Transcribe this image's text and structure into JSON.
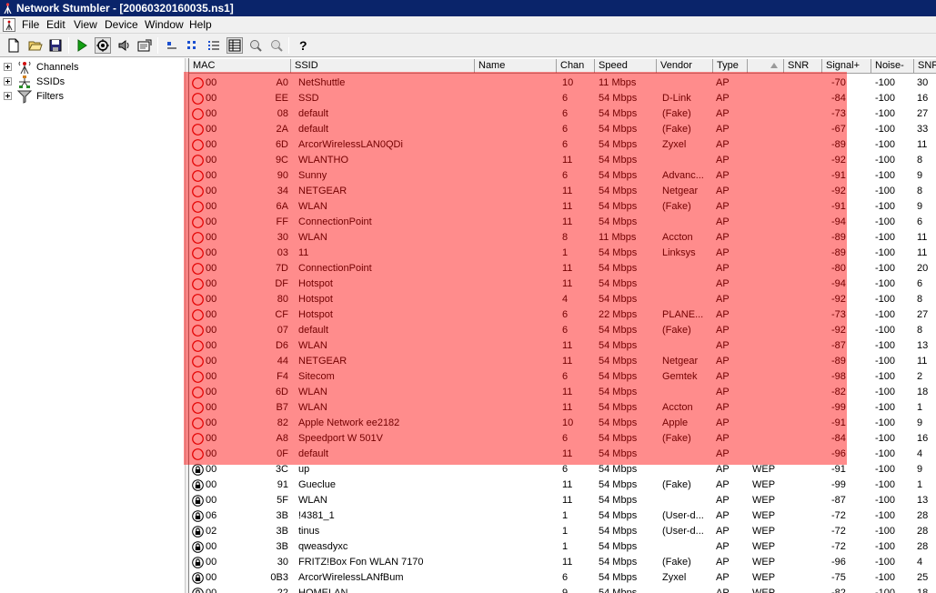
{
  "window": {
    "title": "Network Stumbler - [20060320160035.ns1]"
  },
  "menu": [
    "File",
    "Edit",
    "View",
    "Device",
    "Window",
    "Help"
  ],
  "toolbar_icons": [
    "new-file-icon",
    "open-folder-icon",
    "save-icon",
    "play-icon",
    "auto-config-icon",
    "speaker-icon",
    "properties-icon",
    "large-icons-icon",
    "small-icons-icon",
    "list-icon",
    "details-icon",
    "zoom-in-icon",
    "zoom-out-icon",
    "help-icon"
  ],
  "tree": [
    {
      "label": "Channels",
      "icon": "antenna-icon"
    },
    {
      "label": "SSIDs",
      "icon": "network-icon"
    },
    {
      "label": "Filters",
      "icon": "funnel-icon"
    }
  ],
  "columns": [
    "MAC",
    "SSID",
    "Name",
    "Chan",
    "Speed",
    "Vendor",
    "Type",
    "",
    "SNR",
    "Signal+",
    "Noise-",
    "SNR"
  ],
  "rows": [
    {
      "icon": "open",
      "mac": "00",
      "mac_tail": "A0",
      "ssid": "NetShuttle",
      "chan": "10",
      "speed": "11 Mbps",
      "vendor": "",
      "type": "AP",
      "enc": "",
      "signal": "-70",
      "noise": "-100",
      "snr": "30"
    },
    {
      "icon": "open",
      "mac": "00",
      "mac_tail": "EE",
      "ssid": "SSD",
      "chan": "6",
      "speed": "54 Mbps",
      "vendor": "D-Link",
      "type": "AP",
      "enc": "",
      "signal": "-84",
      "noise": "-100",
      "snr": "16"
    },
    {
      "icon": "open",
      "mac": "00",
      "mac_tail": "08",
      "ssid": "default",
      "chan": "6",
      "speed": "54 Mbps",
      "vendor": "(Fake)",
      "type": "AP",
      "enc": "",
      "signal": "-73",
      "noise": "-100",
      "snr": "27"
    },
    {
      "icon": "open",
      "mac": "00",
      "mac_tail": "2A",
      "ssid": "default",
      "chan": "6",
      "speed": "54 Mbps",
      "vendor": "(Fake)",
      "type": "AP",
      "enc": "",
      "signal": "-67",
      "noise": "-100",
      "snr": "33"
    },
    {
      "icon": "open",
      "mac": "00",
      "mac_tail": "6D",
      "ssid": "ArcorWirelessLAN0QDi",
      "chan": "6",
      "speed": "54 Mbps",
      "vendor": "Zyxel",
      "type": "AP",
      "enc": "",
      "signal": "-89",
      "noise": "-100",
      "snr": "11"
    },
    {
      "icon": "open",
      "mac": "00",
      "mac_tail": "9C",
      "ssid": "WLANTHO",
      "chan": "11",
      "speed": "54 Mbps",
      "vendor": "",
      "type": "AP",
      "enc": "",
      "signal": "-92",
      "noise": "-100",
      "snr": "8"
    },
    {
      "icon": "open",
      "mac": "00",
      "mac_tail": "90",
      "ssid": "Sunny",
      "chan": "6",
      "speed": "54 Mbps",
      "vendor": "Advanc...",
      "type": "AP",
      "enc": "",
      "signal": "-91",
      "noise": "-100",
      "snr": "9"
    },
    {
      "icon": "open",
      "mac": "00",
      "mac_tail": "34",
      "ssid": "NETGEAR",
      "chan": "11",
      "speed": "54 Mbps",
      "vendor": "Netgear",
      "type": "AP",
      "enc": "",
      "signal": "-92",
      "noise": "-100",
      "snr": "8"
    },
    {
      "icon": "open",
      "mac": "00",
      "mac_tail": "6A",
      "ssid": "WLAN",
      "chan": "11",
      "speed": "54 Mbps",
      "vendor": "(Fake)",
      "type": "AP",
      "enc": "",
      "signal": "-91",
      "noise": "-100",
      "snr": "9"
    },
    {
      "icon": "open",
      "mac": "00",
      "mac_tail": "FF",
      "ssid": "ConnectionPoint",
      "chan": "11",
      "speed": "54 Mbps",
      "vendor": "",
      "type": "AP",
      "enc": "",
      "signal": "-94",
      "noise": "-100",
      "snr": "6"
    },
    {
      "icon": "open",
      "mac": "00",
      "mac_tail": "30",
      "ssid": "WLAN",
      "chan": "8",
      "speed": "11 Mbps",
      "vendor": "Accton",
      "type": "AP",
      "enc": "",
      "signal": "-89",
      "noise": "-100",
      "snr": "11"
    },
    {
      "icon": "open",
      "mac": "00",
      "mac_tail": "03",
      "ssid": "11",
      "chan": "1",
      "speed": "54 Mbps",
      "vendor": "Linksys",
      "type": "AP",
      "enc": "",
      "signal": "-89",
      "noise": "-100",
      "snr": "11"
    },
    {
      "icon": "open",
      "mac": "00",
      "mac_tail": "7D",
      "ssid": "ConnectionPoint",
      "chan": "11",
      "speed": "54 Mbps",
      "vendor": "",
      "type": "AP",
      "enc": "",
      "signal": "-80",
      "noise": "-100",
      "snr": "20"
    },
    {
      "icon": "open",
      "mac": "00",
      "mac_tail": "DF",
      "ssid": "Hotspot",
      "chan": "11",
      "speed": "54 Mbps",
      "vendor": "",
      "type": "AP",
      "enc": "",
      "signal": "-94",
      "noise": "-100",
      "snr": "6"
    },
    {
      "icon": "open",
      "mac": "00",
      "mac_tail": "80",
      "ssid": "Hotspot",
      "chan": "4",
      "speed": "54 Mbps",
      "vendor": "",
      "type": "AP",
      "enc": "",
      "signal": "-92",
      "noise": "-100",
      "snr": "8"
    },
    {
      "icon": "open",
      "mac": "00",
      "mac_tail": "CF",
      "ssid": "Hotspot",
      "chan": "6",
      "speed": "22 Mbps",
      "vendor": "PLANE...",
      "type": "AP",
      "enc": "",
      "signal": "-73",
      "noise": "-100",
      "snr": "27"
    },
    {
      "icon": "open",
      "mac": "00",
      "mac_tail": "07",
      "ssid": "default",
      "chan": "6",
      "speed": "54 Mbps",
      "vendor": "(Fake)",
      "type": "AP",
      "enc": "",
      "signal": "-92",
      "noise": "-100",
      "snr": "8"
    },
    {
      "icon": "open",
      "mac": "00",
      "mac_tail": "D6",
      "ssid": "WLAN",
      "chan": "11",
      "speed": "54 Mbps",
      "vendor": "",
      "type": "AP",
      "enc": "",
      "signal": "-87",
      "noise": "-100",
      "snr": "13"
    },
    {
      "icon": "open",
      "mac": "00",
      "mac_tail": "44",
      "ssid": "NETGEAR",
      "chan": "11",
      "speed": "54 Mbps",
      "vendor": "Netgear",
      "type": "AP",
      "enc": "",
      "signal": "-89",
      "noise": "-100",
      "snr": "11"
    },
    {
      "icon": "open",
      "mac": "00",
      "mac_tail": "F4",
      "ssid": "Sitecom",
      "chan": "6",
      "speed": "54 Mbps",
      "vendor": "Gemtek",
      "type": "AP",
      "enc": "",
      "signal": "-98",
      "noise": "-100",
      "snr": "2"
    },
    {
      "icon": "open",
      "mac": "00",
      "mac_tail": "6D",
      "ssid": "WLAN",
      "chan": "11",
      "speed": "54 Mbps",
      "vendor": "",
      "type": "AP",
      "enc": "",
      "signal": "-82",
      "noise": "-100",
      "snr": "18"
    },
    {
      "icon": "open",
      "mac": "00",
      "mac_tail": "B7",
      "ssid": "WLAN",
      "chan": "11",
      "speed": "54 Mbps",
      "vendor": "Accton",
      "type": "AP",
      "enc": "",
      "signal": "-99",
      "noise": "-100",
      "snr": "1"
    },
    {
      "icon": "open",
      "mac": "00",
      "mac_tail": "82",
      "ssid": "Apple Network ee2182",
      "chan": "10",
      "speed": "54 Mbps",
      "vendor": "Apple",
      "type": "AP",
      "enc": "",
      "signal": "-91",
      "noise": "-100",
      "snr": "9"
    },
    {
      "icon": "open",
      "mac": "00",
      "mac_tail": "A8",
      "ssid": "Speedport W 501V",
      "chan": "6",
      "speed": "54 Mbps",
      "vendor": "(Fake)",
      "type": "AP",
      "enc": "",
      "signal": "-84",
      "noise": "-100",
      "snr": "16"
    },
    {
      "icon": "open",
      "mac": "00",
      "mac_tail": "0F",
      "ssid": "default",
      "chan": "11",
      "speed": "54 Mbps",
      "vendor": "",
      "type": "AP",
      "enc": "",
      "signal": "-96",
      "noise": "-100",
      "snr": "4"
    },
    {
      "icon": "locked",
      "mac": "00",
      "mac_tail": "3C",
      "ssid": "up",
      "chan": "6",
      "speed": "54 Mbps",
      "vendor": "",
      "type": "AP",
      "enc": "WEP",
      "signal": "-91",
      "noise": "-100",
      "snr": "9"
    },
    {
      "icon": "locked",
      "mac": "00",
      "mac_tail": "91",
      "ssid": "Gueclue",
      "chan": "11",
      "speed": "54 Mbps",
      "vendor": "(Fake)",
      "type": "AP",
      "enc": "WEP",
      "signal": "-99",
      "noise": "-100",
      "snr": "1"
    },
    {
      "icon": "locked",
      "mac": "00",
      "mac_tail": "5F",
      "ssid": "WLAN",
      "chan": "11",
      "speed": "54 Mbps",
      "vendor": "",
      "type": "AP",
      "enc": "WEP",
      "signal": "-87",
      "noise": "-100",
      "snr": "13"
    },
    {
      "icon": "locked",
      "mac": "06",
      "mac_tail": "3B",
      "ssid": "!4381_1",
      "chan": "1",
      "speed": "54 Mbps",
      "vendor": "(User-d...",
      "type": "AP",
      "enc": "WEP",
      "signal": "-72",
      "noise": "-100",
      "snr": "28"
    },
    {
      "icon": "locked",
      "mac": "02",
      "mac_tail": "3B",
      "ssid": "tinus",
      "chan": "1",
      "speed": "54 Mbps",
      "vendor": "(User-d...",
      "type": "AP",
      "enc": "WEP",
      "signal": "-72",
      "noise": "-100",
      "snr": "28"
    },
    {
      "icon": "locked",
      "mac": "00",
      "mac_tail": "3B",
      "ssid": "qweasdyxc",
      "chan": "1",
      "speed": "54 Mbps",
      "vendor": "",
      "type": "AP",
      "enc": "WEP",
      "signal": "-72",
      "noise": "-100",
      "snr": "28"
    },
    {
      "icon": "locked",
      "mac": "00",
      "mac_tail": "30",
      "ssid": "FRITZ!Box Fon WLAN 7170",
      "chan": "11",
      "speed": "54 Mbps",
      "vendor": "(Fake)",
      "type": "AP",
      "enc": "WEP",
      "signal": "-96",
      "noise": "-100",
      "snr": "4"
    },
    {
      "icon": "locked",
      "mac": "00",
      "mac_tail": "0B3",
      "ssid": "ArcorWirelessLANfBum",
      "chan": "6",
      "speed": "54 Mbps",
      "vendor": "Zyxel",
      "type": "AP",
      "enc": "WEP",
      "signal": "-75",
      "noise": "-100",
      "snr": "25"
    },
    {
      "icon": "locked",
      "mac": "00",
      "mac_tail": "22",
      "ssid": "HOMELAN",
      "chan": "9",
      "speed": "54 Mbps",
      "vendor": "",
      "type": "AP",
      "enc": "WEP",
      "signal": "-82",
      "noise": "-100",
      "snr": "18"
    }
  ],
  "colors": {
    "titlebar": "#0a246a",
    "highlight": "#ff0000",
    "open_icon": "#cc0000"
  }
}
